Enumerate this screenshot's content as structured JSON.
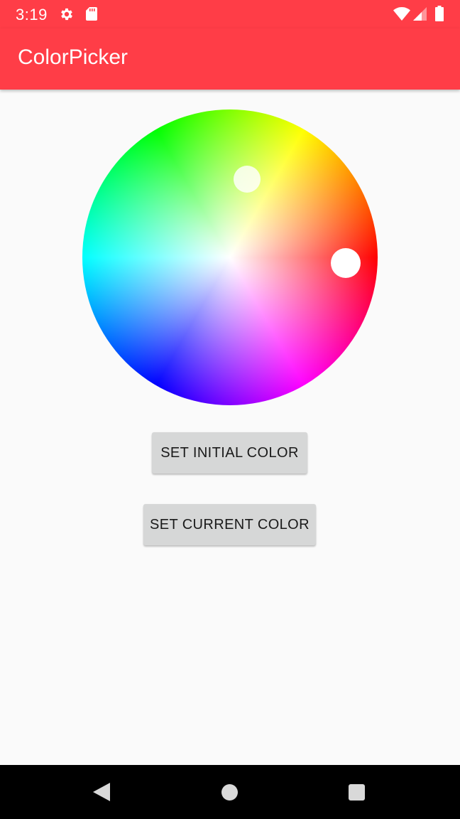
{
  "status_bar": {
    "time": "3:19",
    "icons": [
      "gear-icon",
      "sd-card-icon",
      "wifi-icon",
      "signal-icon",
      "battery-icon"
    ],
    "background": "#ff3d47"
  },
  "app_bar": {
    "title": "ColorPicker",
    "background": "#ff3d47"
  },
  "color_wheel": {
    "handles": [
      "initial-color-handle",
      "current-color-handle"
    ]
  },
  "buttons": {
    "set_initial": "SET INITIAL COLOR",
    "set_current": "SET CURRENT COLOR"
  },
  "nav_bar": {
    "icons": [
      "back-icon",
      "home-icon",
      "recents-icon"
    ]
  }
}
